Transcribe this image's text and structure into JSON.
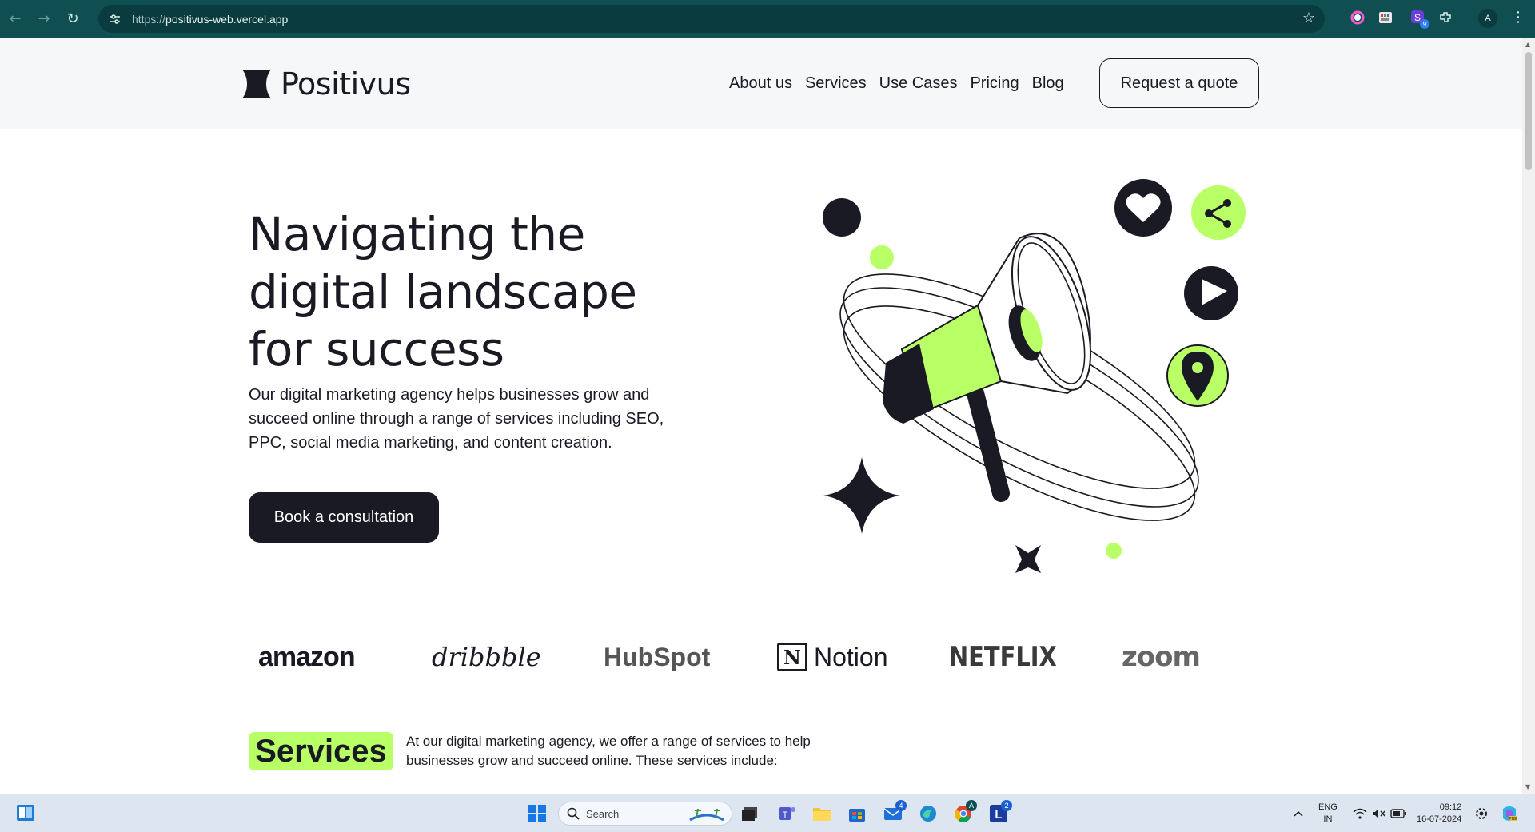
{
  "browser": {
    "url_scheme": "https://",
    "url_host": "positivus-web.vercel.app",
    "profile_initial": "A",
    "extension_badge": "9"
  },
  "site": {
    "brand": "Positivus",
    "nav": [
      "About us",
      "Services",
      "Use Cases",
      "Pricing",
      "Blog"
    ],
    "quote_button": "Request a quote",
    "hero": {
      "title": "Navigating the digital landscape for success",
      "text": "Our digital marketing agency helps businesses grow and succeed online through a range of services including SEO, PPC, social media marketing, and content creation.",
      "cta": "Book a consultation"
    },
    "logos": [
      "amazon",
      "dribbble",
      "HubSpot",
      "Notion",
      "NETFLIX",
      "zoom"
    ],
    "services": {
      "heading": "Services",
      "text": "At our digital marketing agency, we offer a range of services to help businesses grow and succeed online. These services include:"
    },
    "colors": {
      "accent": "#b9ff66",
      "dark": "#191a23",
      "header_bg": "#f6f7f9"
    }
  },
  "taskbar": {
    "search_placeholder": "Search",
    "mail_badge": "4",
    "chrome_badge": "A",
    "l_app_badge": "2",
    "lang_top": "ENG",
    "lang_bottom": "IN",
    "time": "09:12",
    "date": "16-07-2024"
  }
}
